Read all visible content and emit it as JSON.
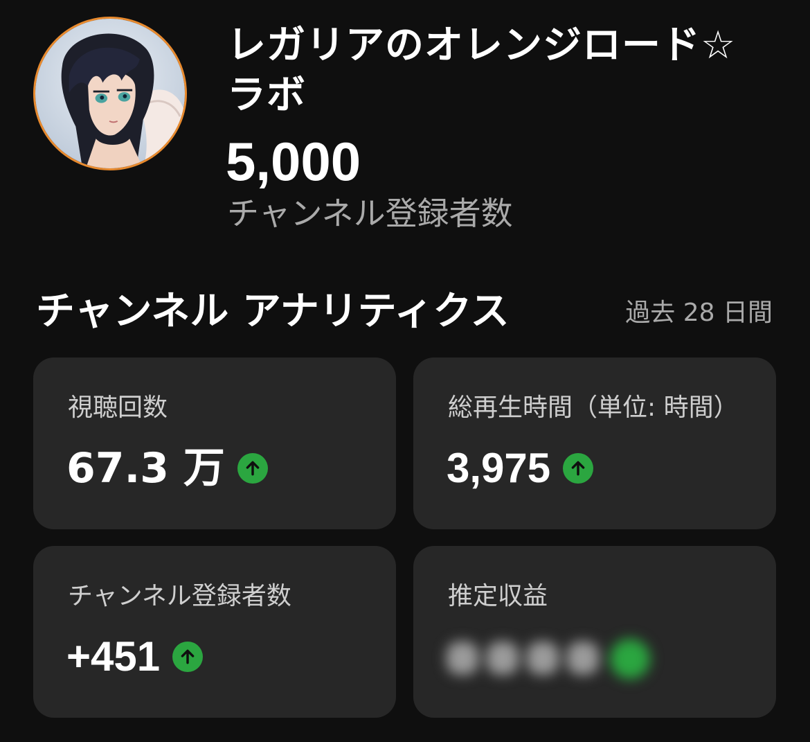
{
  "channel": {
    "name": "レガリアのオレンジロード☆ラボ",
    "subscriber_count": "5,000",
    "subscriber_label": "チャンネル登録者数"
  },
  "analytics": {
    "title": "チャンネル アナリティクス",
    "period": "過去 28 日間",
    "cards": [
      {
        "label": "視聴回数",
        "value": "67.3 万",
        "trend": "up"
      },
      {
        "label": "総再生時間（単位: 時間）",
        "value": "3,975",
        "trend": "up"
      },
      {
        "label": "チャンネル登録者数",
        "value": "+451",
        "trend": "up"
      },
      {
        "label": "推定収益",
        "value": null,
        "value_hidden": true,
        "trend": "up"
      }
    ]
  },
  "colors": {
    "background": "#0f0f0f",
    "card": "#272727",
    "trend_up": "#2ba640",
    "avatar_ring": "#e88a2e"
  },
  "icons": {
    "avatar": "anime-character-avatar",
    "trend": "arrow-up-icon"
  }
}
